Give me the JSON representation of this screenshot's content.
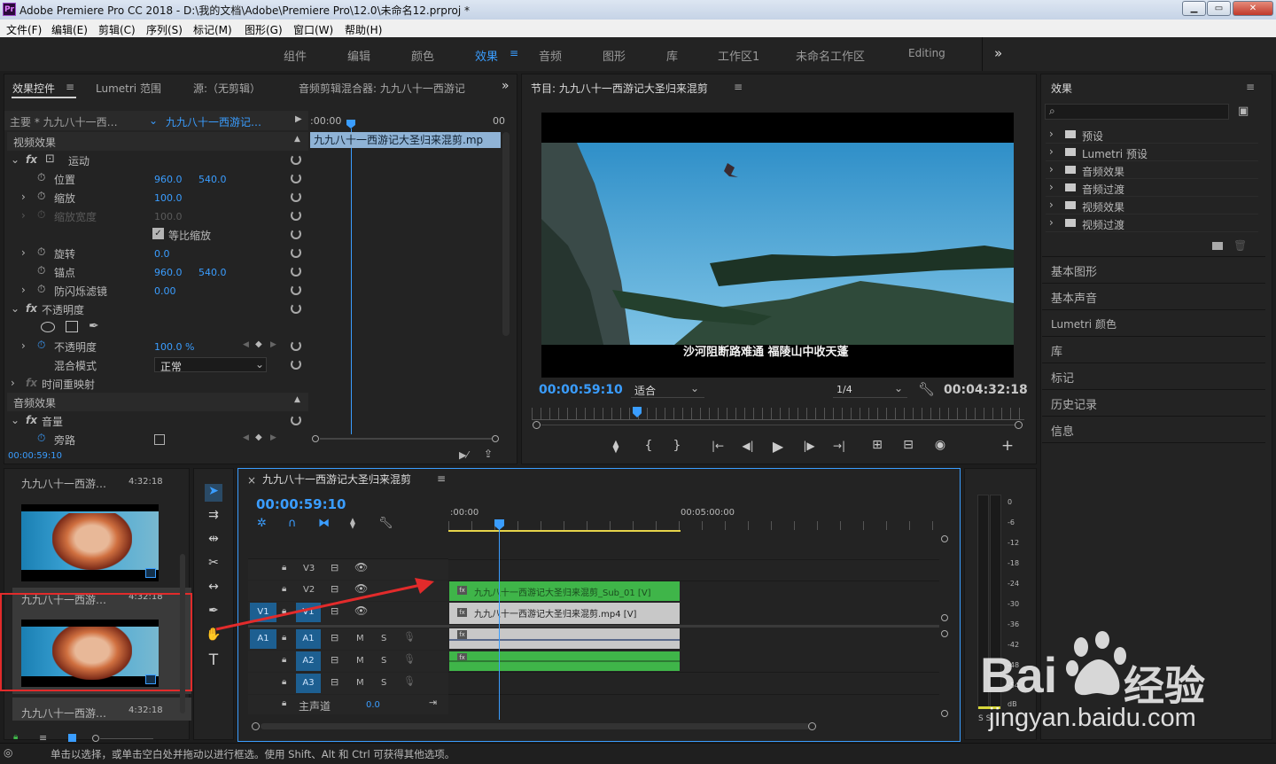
{
  "window": {
    "title": "Adobe Premiere Pro CC 2018 - D:\\我的文档\\Adobe\\Premiere Pro\\12.0\\未命名12.prproj *",
    "app_icon": "Pr",
    "minimize": "▁",
    "maximize": "▭",
    "close": "✕"
  },
  "menu": [
    "文件(F)",
    "编辑(E)",
    "剪辑(C)",
    "序列(S)",
    "标记(M)",
    "图形(G)",
    "窗口(W)",
    "帮助(H)"
  ],
  "workspaces": [
    "组件",
    "编辑",
    "颜色",
    "效果",
    "音频",
    "图形",
    "库",
    "工作区1",
    "未命名工作区",
    "Editing",
    "»"
  ],
  "active_workspace": "效果",
  "effect_controls": {
    "tabs": [
      "效果控件",
      "Lumetri 范围",
      "源:（无剪辑）",
      "音频剪辑混合器: 九九八十一西游记"
    ],
    "more": "»",
    "master": "主要 * 九九八十一西…",
    "clip": "九九八十一西游记…",
    "mini_time": ":00:00",
    "mini_time_end": "00",
    "clip_bar": "九九八十一西游记大圣归来混剪.mp",
    "video_effects": "视频效果",
    "motion": "运动",
    "position": {
      "label": "位置",
      "x": "960.0",
      "y": "540.0"
    },
    "scale": {
      "label": "缩放",
      "value": "100.0"
    },
    "scale_width": {
      "label": "缩放宽度",
      "value": "100.0"
    },
    "uniform_scale": "等比缩放",
    "rotation": {
      "label": "旋转",
      "value": "0.0"
    },
    "anchor": {
      "label": "锚点",
      "x": "960.0",
      "y": "540.0"
    },
    "antiflicker": {
      "label": "防闪烁滤镜",
      "value": "0.00"
    },
    "opacity_group": "不透明度",
    "opacity": {
      "label": "不透明度",
      "value": "100.0 %"
    },
    "blend": {
      "label": "混合模式",
      "value": "正常"
    },
    "time_remap": "时间重映射",
    "audio_effects": "音频效果",
    "volume": "音量",
    "bypass": "旁路",
    "fx": "fx",
    "timecode": "00:00:59:10"
  },
  "program": {
    "title": "节目: 九九八十一西游记大圣归来混剪",
    "subtitle": "沙河阻断路难通 福陵山中收天蓬",
    "timecode": "00:00:59:10",
    "fit": "适合",
    "resolution": "1/4",
    "duration": "00:04:32:18",
    "controls": [
      "⧫",
      "{",
      "}",
      "|←",
      "◀|",
      "▶",
      "|▶",
      "→|",
      "⊞",
      "⊟",
      "◉",
      "+"
    ]
  },
  "effects_panel": {
    "title": "效果",
    "search_placeholder": "",
    "folders": [
      "预设",
      "Lumetri 预设",
      "音频效果",
      "音频过渡",
      "视频效果",
      "视频过渡"
    ],
    "other_panels": [
      "基本图形",
      "基本声音",
      "Lumetri 颜色",
      "库",
      "标记",
      "历史记录",
      "信息"
    ]
  },
  "project": {
    "items": [
      {
        "name": "九九八十一西游…",
        "duration": "4:32:18"
      },
      {
        "name": "九九八十一西游…",
        "duration": "4:32:18"
      },
      {
        "name": "九九八十一西游…",
        "duration": "4:32:18"
      }
    ]
  },
  "timeline": {
    "close": "×",
    "title": "九九八十一西游记大圣归来混剪",
    "timecode": "00:00:59:10",
    "ruler_start": ":00:00",
    "ruler_mid": "00:05:00:00",
    "tracks_video": [
      "V3",
      "V2",
      "V1"
    ],
    "tracks_audio": [
      "A1",
      "A2",
      "A3"
    ],
    "source_v": "V1",
    "source_a": "A1",
    "master": "主声道",
    "master_value": "0.0",
    "clip_sub": "九九八十一西游记大圣归来混剪_Sub_01 [V]",
    "clip_main": "九九八十一西游记大圣归来混剪.mp4 [V]",
    "clip_fx": "fx",
    "m": "M",
    "s": "S"
  },
  "meter": {
    "scale": [
      "0",
      "-6",
      "-12",
      "-18",
      "-24",
      "-30",
      "-36",
      "-42",
      "-48",
      "-54",
      "dB"
    ],
    "s_label": "S S"
  },
  "status": "单击以选择，或单击空白处并拖动以进行框选。使用 Shift、Alt 和 Ctrl 可获得其他选项。",
  "watermark": {
    "brand": "Bai",
    "cn": "经验",
    "url": "jingyan.baidu.com"
  },
  "colors": {
    "accent": "#3a9dff",
    "track_blue": "#1d5f91",
    "clip_green": "#3fb549",
    "annotation_red": "#e22b2b"
  }
}
